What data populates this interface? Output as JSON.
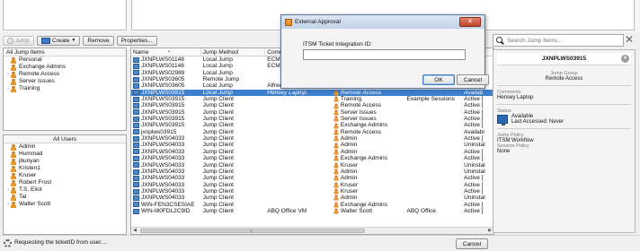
{
  "toolbar": {
    "jump_label": "Jump",
    "create_label": "Create",
    "remove_label": "Remove",
    "properties_label": "Properties..."
  },
  "jump_items_tree": {
    "header": "All Jump Items",
    "items": [
      {
        "label": "Personal",
        "expandable": false
      },
      {
        "label": "Exchange Admins",
        "expandable": false
      },
      {
        "label": "Remote Access",
        "expandable": true
      },
      {
        "label": "Server Issues",
        "expandable": false
      },
      {
        "label": "Training",
        "expandable": true
      }
    ]
  },
  "users_list": {
    "header": "All Users",
    "items": [
      {
        "label": "Admin",
        "expandable": false
      },
      {
        "label": "Hummad",
        "expandable": false
      },
      {
        "label": "jbunyan",
        "expandable": false
      },
      {
        "label": "Kristen1",
        "expandable": false
      },
      {
        "label": "Kruser",
        "expandable": false
      },
      {
        "label": "Robert Frost",
        "expandable": false
      },
      {
        "label": "T.S. Eliot",
        "expandable": true
      },
      {
        "label": "Tal",
        "expandable": false
      },
      {
        "label": "Walter Scott",
        "expandable": true
      }
    ]
  },
  "grid": {
    "columns": [
      "Name",
      "Jump Method",
      "Comm",
      "",
      "",
      "",
      ""
    ],
    "rows": [
      {
        "name": "JXNPLWS01148",
        "method": "Local Jump",
        "comments": "ECM",
        "group": "",
        "session": "",
        "status": ""
      },
      {
        "name": "JXNPLWS01148",
        "method": "Local Jump",
        "comments": "ECM",
        "group": "",
        "session": "",
        "status": ""
      },
      {
        "name": "JXNPLWS02989",
        "method": "Local Jump",
        "comments": "",
        "group": "",
        "session": "",
        "status": ""
      },
      {
        "name": "JXNPLWS03605",
        "method": "Remote Jump",
        "comments": "",
        "group": "",
        "session": "",
        "status": ""
      },
      {
        "name": "JXNPLWS03605",
        "method": "Local Jump",
        "comments": "Alfred",
        "group": "",
        "session": "",
        "status": ""
      },
      {
        "name": "JXNPLWS03915",
        "method": "Local Jump",
        "comments": "Hensey Laptop",
        "group": "Remote Access",
        "session": "",
        "status": "Availab",
        "selected": true
      },
      {
        "name": "JXNPLWS03915",
        "method": "Jump Client",
        "comments": "",
        "group": "Training",
        "session": "Example Sessions",
        "status": "Active ["
      },
      {
        "name": "JXNPLWS03915",
        "method": "Jump Client",
        "comments": "",
        "group": "Remote Access",
        "session": "",
        "status": "Active ["
      },
      {
        "name": "JXNPLWS03915",
        "method": "Jump Client",
        "comments": "",
        "group": "Server Issues",
        "session": "",
        "status": "Active ["
      },
      {
        "name": "JXNPLWS03915",
        "method": "Jump Client",
        "comments": "",
        "group": "Server Issues",
        "session": "",
        "status": "Active ["
      },
      {
        "name": "JXNPLWS03915",
        "method": "Jump Client",
        "comments": "",
        "group": "Exchange Admins",
        "session": "",
        "status": "Active ["
      },
      {
        "name": "jxnplws03915",
        "method": "Jump Client",
        "comments": "",
        "group": "Remote Access",
        "session": "",
        "status": "Availabl"
      },
      {
        "name": "JXNPLWS04033",
        "method": "Jump Client",
        "comments": "",
        "group": "Admin",
        "session": "",
        "status": "Active ["
      },
      {
        "name": "JXNPLWS04033",
        "method": "Jump Client",
        "comments": "",
        "group": "Admin",
        "session": "",
        "status": "Uninstal"
      },
      {
        "name": "JXNPLWS04033",
        "method": "Jump Client",
        "comments": "",
        "group": "Admin",
        "session": "",
        "status": "Active ["
      },
      {
        "name": "JXNPLWS04033",
        "method": "Jump Client",
        "comments": "",
        "group": "Exchange Admins",
        "session": "",
        "status": "Active ["
      },
      {
        "name": "JXNPLWS04033",
        "method": "Jump Client",
        "comments": "",
        "group": "Kruser",
        "session": "",
        "status": "Uninstal"
      },
      {
        "name": "JXNPLWS04033",
        "method": "Jump Client",
        "comments": "",
        "group": "Admin",
        "session": "",
        "status": "Uninstal"
      },
      {
        "name": "JXNPLWS04033",
        "method": "Jump Client",
        "comments": "",
        "group": "Admin",
        "session": "",
        "status": "Active ["
      },
      {
        "name": "JXNPLWS04033",
        "method": "Jump Client",
        "comments": "",
        "group": "Kruser",
        "session": "",
        "status": "Active ["
      },
      {
        "name": "JXNPLWS04033",
        "method": "Jump Client",
        "comments": "",
        "group": "Kruser",
        "session": "",
        "status": "Active ["
      },
      {
        "name": "JXNPLWS04033",
        "method": "Jump Client",
        "comments": "",
        "group": "Admin",
        "session": "",
        "status": "Uninstal"
      },
      {
        "name": "WIN-FEN3CSESIAE",
        "method": "Jump Client",
        "comments": "",
        "group": "Exchange Admins",
        "session": "",
        "status": "Active ["
      },
      {
        "name": "WIN-I80FDL2C9ID",
        "method": "Jump Client",
        "comments": "ABQ Office VM",
        "group": "Walter Scott",
        "session": "ABQ Office",
        "status": "Active ["
      }
    ]
  },
  "search": {
    "placeholder": "Search Jump Items..."
  },
  "details": {
    "title": "JXNPLWS03915",
    "group_label": "Jump Group",
    "group_value": "Remote Access",
    "comments_label": "Comments",
    "comments_value": "Hensey Laptop",
    "status_label": "Status",
    "status_value": "Available",
    "last_accessed": "Last Accessed: Never",
    "jump_policy_label": "Jump Policy",
    "jump_policy_value": "ITSM Workflow",
    "session_policy_label": "Session Policy",
    "session_policy_value": "None"
  },
  "bottom": {
    "status_text": "Requesting the ticketID from user....",
    "cancel_label": "Cancel"
  },
  "dialog": {
    "title": "External Approval",
    "field_label": "ITSM Ticket Integration ID:",
    "field_value": "",
    "ok_label": "OK",
    "cancel_label": "Cancel"
  },
  "colors": {
    "selection": "#3c7fcf",
    "user_icon": "#e7952f",
    "client_icon": "#4f88c4",
    "dialog_close": "#c14326"
  }
}
